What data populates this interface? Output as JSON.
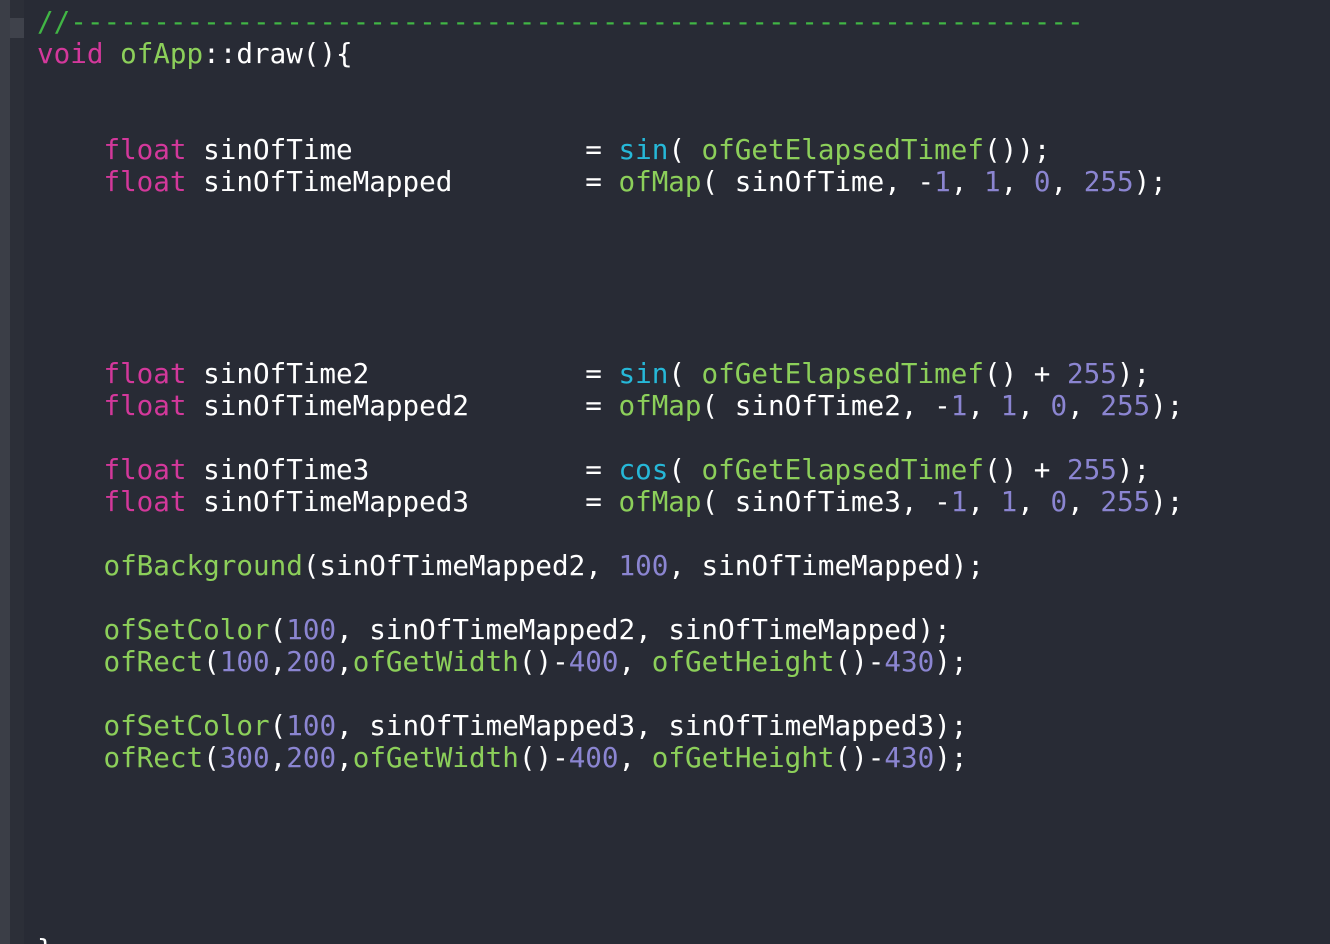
{
  "editor": {
    "colors": {
      "background": "#282b35",
      "comment": "#41b645",
      "keyword": "#d3389b",
      "function": "#8ccf5a",
      "builtin": "#26b8d8",
      "number": "#8b85d1",
      "text": "#ffffff"
    },
    "lines": [
      [
        {
          "t": "//-------------------------------------------------------------",
          "k": "comment"
        }
      ],
      [
        {
          "t": "void",
          "k": "keyword"
        },
        {
          "t": " ",
          "k": "plain"
        },
        {
          "t": "ofApp",
          "k": "fn"
        },
        {
          "t": "::draw(){",
          "k": "plain"
        }
      ],
      [],
      [],
      [
        {
          "t": "    ",
          "k": "plain"
        },
        {
          "t": "float",
          "k": "keyword"
        },
        {
          "t": " sinOfTime              = ",
          "k": "plain"
        },
        {
          "t": "sin",
          "k": "builtin"
        },
        {
          "t": "( ",
          "k": "plain"
        },
        {
          "t": "ofGetElapsedTimef",
          "k": "fn"
        },
        {
          "t": "());",
          "k": "plain"
        }
      ],
      [
        {
          "t": "    ",
          "k": "plain"
        },
        {
          "t": "float",
          "k": "keyword"
        },
        {
          "t": " sinOfTimeMapped        = ",
          "k": "plain"
        },
        {
          "t": "ofMap",
          "k": "fn"
        },
        {
          "t": "( sinOfTime, -",
          "k": "plain"
        },
        {
          "t": "1",
          "k": "num"
        },
        {
          "t": ", ",
          "k": "plain"
        },
        {
          "t": "1",
          "k": "num"
        },
        {
          "t": ", ",
          "k": "plain"
        },
        {
          "t": "0",
          "k": "num"
        },
        {
          "t": ", ",
          "k": "plain"
        },
        {
          "t": "255",
          "k": "num"
        },
        {
          "t": ");",
          "k": "plain"
        }
      ],
      [],
      [],
      [],
      [],
      [],
      [
        {
          "t": "    ",
          "k": "plain"
        },
        {
          "t": "float",
          "k": "keyword"
        },
        {
          "t": " sinOfTime2             = ",
          "k": "plain"
        },
        {
          "t": "sin",
          "k": "builtin"
        },
        {
          "t": "( ",
          "k": "plain"
        },
        {
          "t": "ofGetElapsedTimef",
          "k": "fn"
        },
        {
          "t": "() + ",
          "k": "plain"
        },
        {
          "t": "255",
          "k": "num"
        },
        {
          "t": ");",
          "k": "plain"
        }
      ],
      [
        {
          "t": "    ",
          "k": "plain"
        },
        {
          "t": "float",
          "k": "keyword"
        },
        {
          "t": " sinOfTimeMapped2       = ",
          "k": "plain"
        },
        {
          "t": "ofMap",
          "k": "fn"
        },
        {
          "t": "( sinOfTime2, -",
          "k": "plain"
        },
        {
          "t": "1",
          "k": "num"
        },
        {
          "t": ", ",
          "k": "plain"
        },
        {
          "t": "1",
          "k": "num"
        },
        {
          "t": ", ",
          "k": "plain"
        },
        {
          "t": "0",
          "k": "num"
        },
        {
          "t": ", ",
          "k": "plain"
        },
        {
          "t": "255",
          "k": "num"
        },
        {
          "t": ");",
          "k": "plain"
        }
      ],
      [],
      [
        {
          "t": "    ",
          "k": "plain"
        },
        {
          "t": "float",
          "k": "keyword"
        },
        {
          "t": " sinOfTime3             = ",
          "k": "plain"
        },
        {
          "t": "cos",
          "k": "builtin"
        },
        {
          "t": "( ",
          "k": "plain"
        },
        {
          "t": "ofGetElapsedTimef",
          "k": "fn"
        },
        {
          "t": "() + ",
          "k": "plain"
        },
        {
          "t": "255",
          "k": "num"
        },
        {
          "t": ");",
          "k": "plain"
        }
      ],
      [
        {
          "t": "    ",
          "k": "plain"
        },
        {
          "t": "float",
          "k": "keyword"
        },
        {
          "t": " sinOfTimeMapped3       = ",
          "k": "plain"
        },
        {
          "t": "ofMap",
          "k": "fn"
        },
        {
          "t": "( sinOfTime3, -",
          "k": "plain"
        },
        {
          "t": "1",
          "k": "num"
        },
        {
          "t": ", ",
          "k": "plain"
        },
        {
          "t": "1",
          "k": "num"
        },
        {
          "t": ", ",
          "k": "plain"
        },
        {
          "t": "0",
          "k": "num"
        },
        {
          "t": ", ",
          "k": "plain"
        },
        {
          "t": "255",
          "k": "num"
        },
        {
          "t": ");",
          "k": "plain"
        }
      ],
      [],
      [
        {
          "t": "    ",
          "k": "plain"
        },
        {
          "t": "ofBackground",
          "k": "fn"
        },
        {
          "t": "(sinOfTimeMapped2, ",
          "k": "plain"
        },
        {
          "t": "100",
          "k": "num"
        },
        {
          "t": ", sinOfTimeMapped);",
          "k": "plain"
        }
      ],
      [],
      [
        {
          "t": "    ",
          "k": "plain"
        },
        {
          "t": "ofSetColor",
          "k": "fn"
        },
        {
          "t": "(",
          "k": "plain"
        },
        {
          "t": "100",
          "k": "num"
        },
        {
          "t": ", sinOfTimeMapped2, sinOfTimeMapped);",
          "k": "plain"
        }
      ],
      [
        {
          "t": "    ",
          "k": "plain"
        },
        {
          "t": "ofRect",
          "k": "fn"
        },
        {
          "t": "(",
          "k": "plain"
        },
        {
          "t": "100",
          "k": "num"
        },
        {
          "t": ",",
          "k": "plain"
        },
        {
          "t": "200",
          "k": "num"
        },
        {
          "t": ",",
          "k": "plain"
        },
        {
          "t": "ofGetWidth",
          "k": "fn"
        },
        {
          "t": "()-",
          "k": "plain"
        },
        {
          "t": "400",
          "k": "num"
        },
        {
          "t": ", ",
          "k": "plain"
        },
        {
          "t": "ofGetHeight",
          "k": "fn"
        },
        {
          "t": "()-",
          "k": "plain"
        },
        {
          "t": "430",
          "k": "num"
        },
        {
          "t": ");",
          "k": "plain"
        }
      ],
      [],
      [
        {
          "t": "    ",
          "k": "plain"
        },
        {
          "t": "ofSetColor",
          "k": "fn"
        },
        {
          "t": "(",
          "k": "plain"
        },
        {
          "t": "100",
          "k": "num"
        },
        {
          "t": ", sinOfTimeMapped3, sinOfTimeMapped3);",
          "k": "plain"
        }
      ],
      [
        {
          "t": "    ",
          "k": "plain"
        },
        {
          "t": "ofRect",
          "k": "fn"
        },
        {
          "t": "(",
          "k": "plain"
        },
        {
          "t": "300",
          "k": "num"
        },
        {
          "t": ",",
          "k": "plain"
        },
        {
          "t": "200",
          "k": "num"
        },
        {
          "t": ",",
          "k": "plain"
        },
        {
          "t": "ofGetWidth",
          "k": "fn"
        },
        {
          "t": "()-",
          "k": "plain"
        },
        {
          "t": "400",
          "k": "num"
        },
        {
          "t": ", ",
          "k": "plain"
        },
        {
          "t": "ofGetHeight",
          "k": "fn"
        },
        {
          "t": "()-",
          "k": "plain"
        },
        {
          "t": "430",
          "k": "num"
        },
        {
          "t": ");",
          "k": "plain"
        }
      ],
      [],
      [],
      [],
      [],
      [],
      [
        {
          "t": "}",
          "k": "plain"
        }
      ]
    ]
  }
}
